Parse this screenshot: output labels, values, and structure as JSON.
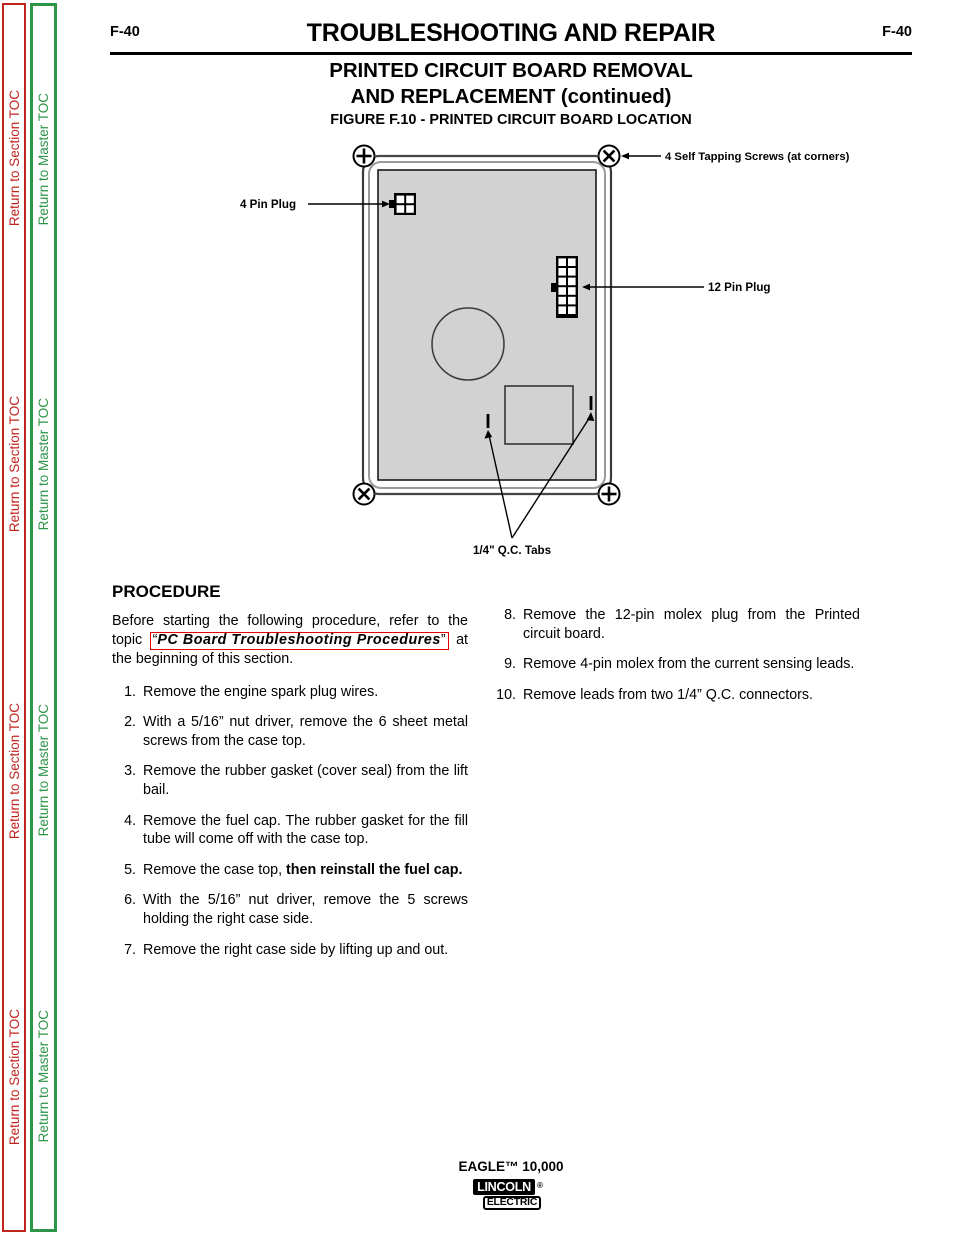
{
  "sidebar": {
    "section_toc": {
      "label": "Return to Section TOC",
      "color": "#c0241f",
      "repeats": 4
    },
    "master_toc": {
      "label": "Return to Master TOC",
      "color": "#2e9448",
      "repeats": 4
    }
  },
  "header": {
    "folio_left": "F-40",
    "folio_right": "F-40",
    "title": "TROUBLESHOOTING AND REPAIR"
  },
  "titles": {
    "section_line1": "PRINTED CIRCUIT BOARD REMOVAL",
    "section_line2": "AND REPLACEMENT (continued)",
    "figure_caption": "FIGURE F.10 - PRINTED CIRCUIT BOARD LOCATION"
  },
  "figure": {
    "labels": {
      "screws": "4 Self Tapping Screws (at corners)",
      "four_pin": "4 Pin Plug",
      "twelve_pin": "12 Pin Plug",
      "qc_tabs": "1/4\" Q.C. Tabs"
    },
    "board_fill": "#d2d2d2",
    "screw_marks": [
      "plus",
      "cross",
      "cross",
      "plus"
    ]
  },
  "procedure": {
    "heading": "PROCEDURE",
    "intro_before": "Before starting the following procedure, refer to the topic",
    "intro_quote_open": "“",
    "intro_topic": "PC Board Troubleshooting Procedures",
    "intro_quote_close": "”",
    "intro_after": "at the beginning of this section.",
    "left_items": [
      {
        "num": "1.",
        "text": "Remove the engine spark plug wires."
      },
      {
        "num": "2.",
        "text": "With a 5/16” nut driver, remove the 6 sheet metal screws from the case top."
      },
      {
        "num": "3.",
        "text": "Remove the rubber gasket (cover seal) from the lift bail."
      },
      {
        "num": "4.",
        "text": "Remove the fuel cap.  The rubber gasket for the fill tube will come off with the case top."
      },
      {
        "num": "5.",
        "text": "Remove the case top, ",
        "bold": "then reinstall the fuel cap."
      },
      {
        "num": "6.",
        "text": "With the 5/16” nut driver, remove the 5 screws holding the right case side."
      },
      {
        "num": "7.",
        "text": "Remove the right case side by lifting up and out."
      }
    ],
    "right_items": [
      {
        "num": "8.",
        "text": "Remove the 12-pin molex plug from the Printed circuit board."
      },
      {
        "num": "9.",
        "text": "Remove 4-pin molex from the current sensing leads."
      },
      {
        "num": "10.",
        "text": "Remove leads  from two 1/4” Q.C. connectors."
      }
    ]
  },
  "footer": {
    "model": "EAGLE™ 10,000",
    "logo_top": "LINCOLN",
    "logo_reg": "®",
    "logo_bottom": "ELECTRIC"
  }
}
